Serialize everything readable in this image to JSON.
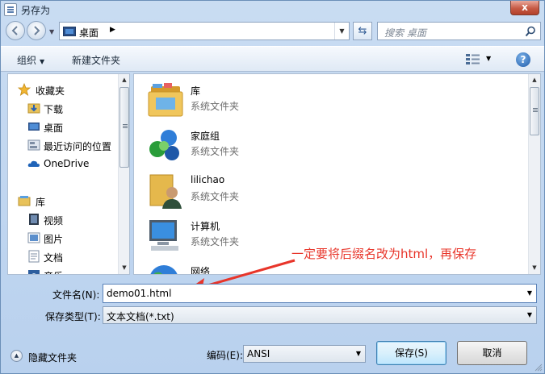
{
  "window": {
    "title": "另存为",
    "close_label": "x"
  },
  "navbar": {
    "breadcrumb": "桌面",
    "search_placeholder": "搜索 桌面"
  },
  "toolbar": {
    "organize": "组织",
    "new_folder": "新建文件夹",
    "help": "?"
  },
  "sidebar": {
    "favorites_label": "收藏夹",
    "favorites": [
      "下载",
      "桌面",
      "最近访问的位置",
      "OneDrive"
    ],
    "libraries_label": "库",
    "libraries": [
      "视频",
      "图片",
      "文档",
      "音乐"
    ]
  },
  "files": [
    {
      "name": "库",
      "type": "系统文件夹",
      "icon": "library-icon"
    },
    {
      "name": "家庭组",
      "type": "系统文件夹",
      "icon": "homegroup-icon"
    },
    {
      "name": "lilichao",
      "type": "系统文件夹",
      "icon": "user-folder-icon"
    },
    {
      "name": "计算机",
      "type": "系统文件夹",
      "icon": "computer-icon"
    },
    {
      "name": "网络",
      "type": "",
      "icon": "network-icon"
    }
  ],
  "annotation": "一定要将后缀名改为html，再保存",
  "form": {
    "filename_label": "文件名(N):",
    "filename_value": "demo01.html",
    "filetype_label": "保存类型(T):",
    "filetype_value": "文本文档(*.txt)",
    "encoding_label": "编码(E):",
    "encoding_value": "ANSI"
  },
  "footer": {
    "hide_folders": "隐藏文件夹",
    "save": "保存(S)",
    "cancel": "取消"
  },
  "colors": {
    "annotation": "#e8352a",
    "window_bg": "#c9dcf2"
  }
}
